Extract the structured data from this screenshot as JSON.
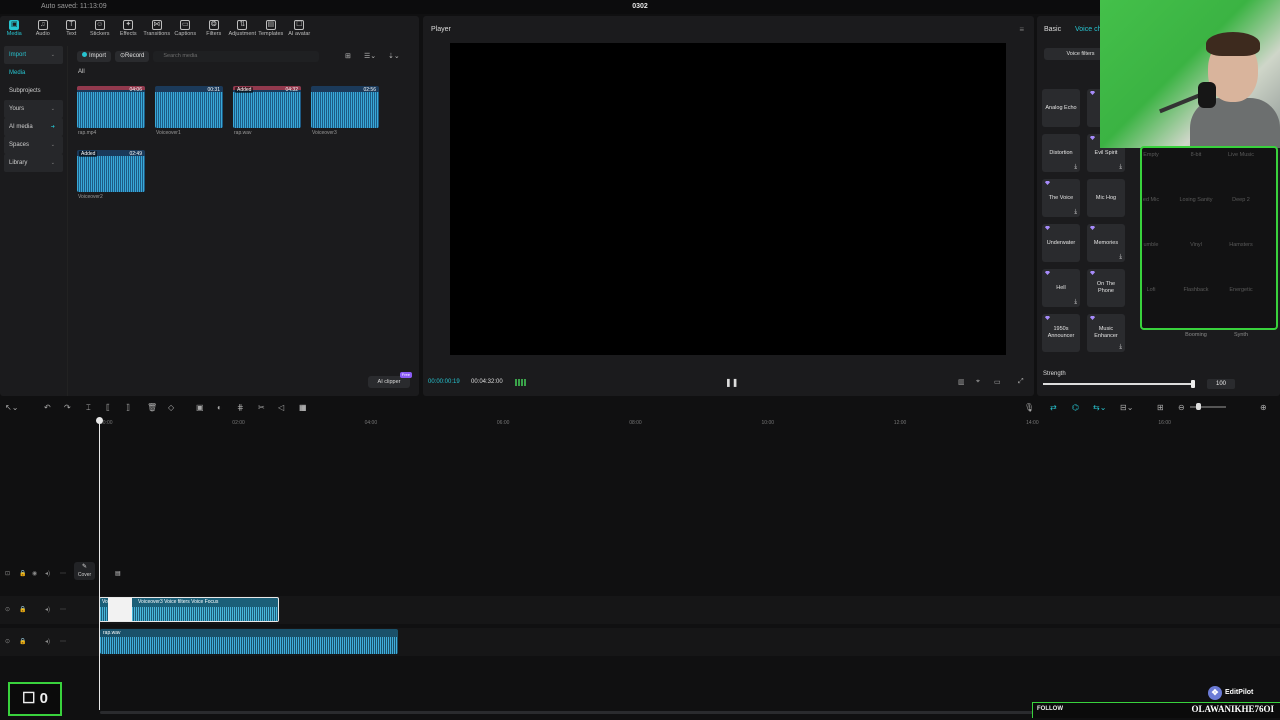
{
  "window": {
    "autosave": "Auto saved: 11:13:09",
    "project": "0302"
  },
  "toolbar_tabs": [
    {
      "label": "Media",
      "icon": "media-icon",
      "glyph": "▣"
    },
    {
      "label": "Audio",
      "icon": "audio-icon",
      "glyph": "♫"
    },
    {
      "label": "Text",
      "icon": "text-icon",
      "glyph": "T"
    },
    {
      "label": "Stickers",
      "icon": "sticker-icon",
      "glyph": "☺"
    },
    {
      "label": "Effects",
      "icon": "effects-icon",
      "glyph": "✦"
    },
    {
      "label": "Transitions",
      "icon": "transitions-icon",
      "glyph": "⋈"
    },
    {
      "label": "Captions",
      "icon": "captions-icon",
      "glyph": "▭"
    },
    {
      "label": "Filters",
      "icon": "filters-icon",
      "glyph": "❂"
    },
    {
      "label": "Adjustment",
      "icon": "adjustment-icon",
      "glyph": "⇅"
    },
    {
      "label": "Templates",
      "icon": "templates-icon",
      "glyph": "▤"
    },
    {
      "label": "AI avatar",
      "icon": "ai-avatar-icon",
      "glyph": "☐"
    }
  ],
  "sidebar": {
    "import": "Import",
    "media": "Media",
    "subprojects": "Subprojects",
    "yours": "Yours",
    "ai_media": "AI media",
    "spaces": "Spaces",
    "library": "Library"
  },
  "mediabar": {
    "import": "Import",
    "record": "Record",
    "search_placeholder": "Search media",
    "all": "All"
  },
  "clips": [
    {
      "name": "rap.mp4",
      "duration": "04:06",
      "added": ""
    },
    {
      "name": "Voiceover1",
      "duration": "00:31",
      "added": ""
    },
    {
      "name": "rap.wav",
      "duration": "04:32",
      "added": "Added"
    },
    {
      "name": "Voiceover3",
      "duration": "02:56",
      "added": ""
    },
    {
      "name": "Voiceover2",
      "duration": "02:49",
      "added": "Added"
    }
  ],
  "ai_clipper": {
    "label": "AI clipper",
    "badge": "Free"
  },
  "player": {
    "title": "Player",
    "current": "00:00:00:19",
    "total": "00:04:32:00"
  },
  "right_panel": {
    "tab_basic": "Basic",
    "tab_voice": "Voice ch",
    "voice_filters": "Voice filters",
    "cards": [
      {
        "label": "Analog Echo",
        "gem": false,
        "dl": false
      },
      {
        "label": "R",
        "gem": true,
        "dl": false
      },
      {
        "label": "Distortion",
        "gem": false,
        "dl": true
      },
      {
        "label": "Evil Spirit",
        "gem": true,
        "dl": true
      },
      {
        "label": "The Voice",
        "gem": true,
        "dl": true
      },
      {
        "label": "Mic Hog",
        "gem": false,
        "dl": false
      },
      {
        "label": "Underwater",
        "gem": true,
        "dl": false
      },
      {
        "label": "Memories",
        "gem": true,
        "dl": true
      },
      {
        "label": "Hell",
        "gem": true,
        "dl": true
      },
      {
        "label": "On The Phone",
        "gem": true,
        "dl": false
      },
      {
        "label": "1950s Announcer",
        "gem": true,
        "dl": false
      },
      {
        "label": "Music Enhancer",
        "gem": true,
        "dl": true
      }
    ],
    "strength_label": "Strength",
    "strength_value": "100"
  },
  "overlay_cells": [
    "Empty",
    "8-bit",
    "Live Music",
    "ed Mic",
    "Losing Sanity",
    "Deep 2",
    "umble",
    "Vinyl",
    "Hamsters",
    "Lofi",
    "Flashback",
    "Energetic",
    "",
    "Booming",
    "Synth"
  ],
  "ruler_ticks": [
    "00:00",
    "02:00",
    "04:00",
    "06:00",
    "08:00",
    "10:00",
    "12:00",
    "14:00",
    "16:00"
  ],
  "timeline": {
    "cover": "Cover",
    "video_clip_label": "Voiceover3   Voice filters Voice Focus",
    "video_clip_prefix": "Vo",
    "audio_clip_label": "rap.wav"
  },
  "overlays": {
    "counter": "☐ 0",
    "follow": "FOLLOW",
    "handle": "OLAWANIKHE76OI",
    "brand": "EditPilot"
  },
  "colors": {
    "accent": "#27c4d0",
    "overlay_green": "#39d23d"
  }
}
